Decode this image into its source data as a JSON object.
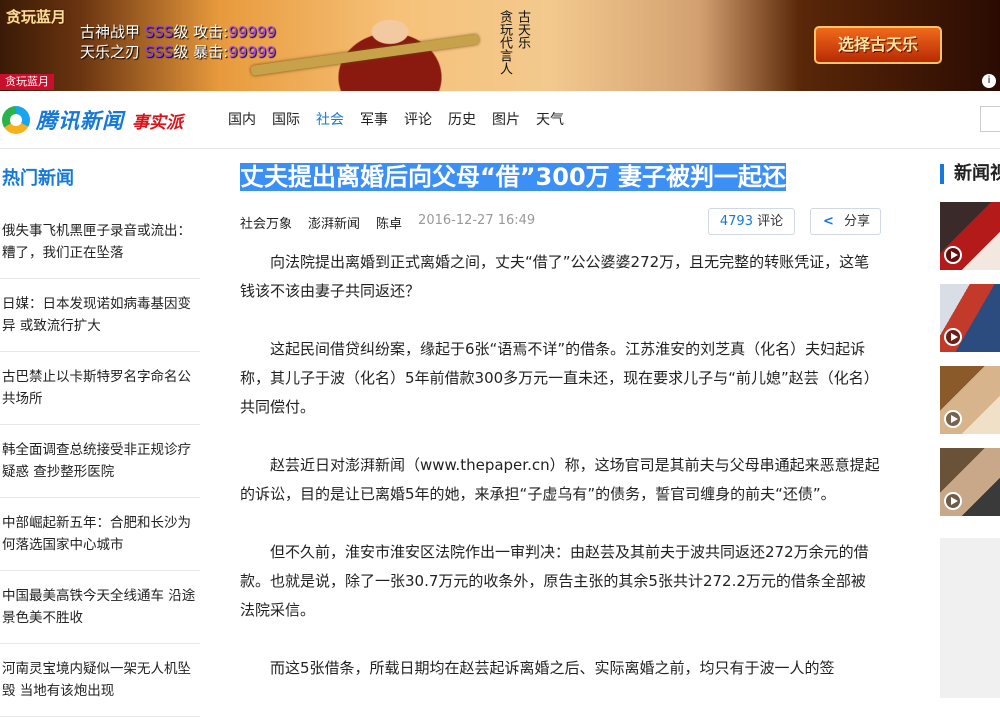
{
  "ad": {
    "logo": "贪玩蓝月",
    "line1_name": "古神战甲",
    "line1_grade": "SSS",
    "line1_level": "级",
    "line1_stat": "攻击:",
    "line1_value": "99999",
    "line2_name": "天乐之刃",
    "line2_grade": "SSS",
    "line2_level": "级",
    "line2_stat": "暴击:",
    "line2_value": "99999",
    "vertical_1": "贪玩代言人",
    "vertical_2": "古天乐",
    "cta": "选择古天乐",
    "tag": "贪玩蓝月",
    "info": "i"
  },
  "header": {
    "brand_name": "腾讯新闻",
    "brand_slogan": "事实派",
    "nav": [
      "国内",
      "国际",
      "社会",
      "军事",
      "评论",
      "历史",
      "图片",
      "天气"
    ],
    "active_nav": "社会"
  },
  "hot": {
    "title": "热门新闻",
    "items": [
      "俄失事飞机黑匣子录音或流出：糟了，我们正在坠落",
      "日媒：日本发现诺如病毒基因变异 或致流行扩大",
      "古巴禁止以卡斯特罗名字命名公共场所",
      "韩全面调查总统接受非正规诊疗疑惑 查抄整形医院",
      "中部崛起新五年：合肥和长沙为何落选国家中心城市",
      "中国最美高铁今天全线通车 沿途景色美不胜收",
      "河南灵宝境内疑似一架无人机坠毁 当地有该炮出现"
    ]
  },
  "article": {
    "title": "丈夫提出离婚后向父母“借”300万 妻子被判一起还",
    "category": "社会万象",
    "source": "澎湃新闻",
    "author": "陈卓",
    "time": "2016-12-27 16:49",
    "comment_count": "4793",
    "comment_label": "评论",
    "share_label": "分享",
    "paragraphs": [
      "向法院提出离婚到正式离婚之间，丈夫“借了”公公婆婆272万，且无完整的转账凭证，这笔钱该不该由妻子共同返还？",
      "这起民间借贷纠纷案，缘起于6张“语焉不详”的借条。江苏淮安的刘芝真（化名）夫妇起诉称，其儿子于波（化名）5年前借款300多万元一直未还，现在要求儿子与“前儿媳”赵芸（化名）共同偿付。",
      "赵芸近日对澎湃新闻（www.thepaper.cn）称，这场官司是其前夫与父母串通起来恶意提起的诉讼，目的是让已离婚5年的她，来承担“子虚乌有”的债务，誓官司缠身的前夫“还债”。",
      "但不久前，淮安市淮安区法院作出一审判决：由赵芸及其前夫于波共同返还272万余元的借款。也就是说，除了一张30.7万元的收条外，原告主张的其余5张共计272.2万元的借条全部被法院采信。",
      "而这5张借条，所载日期均在赵芸起诉离婚之后、实际离婚之前，均只有于波一人的签"
    ]
  },
  "right": {
    "title": "新闻视频"
  },
  "colors": {
    "accent": "#1679d9",
    "highlight": "#3c8ff5",
    "ad_tag": "#c8102e"
  }
}
